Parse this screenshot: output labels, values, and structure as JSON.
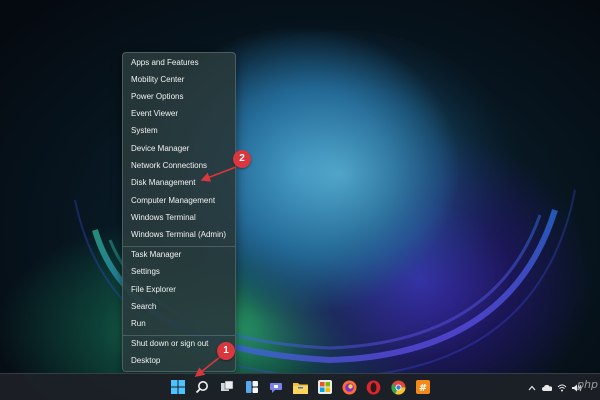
{
  "context_menu": {
    "group1": [
      {
        "label": "Apps and Features"
      },
      {
        "label": "Mobility Center"
      },
      {
        "label": "Power Options"
      },
      {
        "label": "Event Viewer"
      },
      {
        "label": "System"
      },
      {
        "label": "Device Manager"
      },
      {
        "label": "Network Connections"
      },
      {
        "label": "Disk Management"
      },
      {
        "label": "Computer Management"
      },
      {
        "label": "Windows Terminal"
      },
      {
        "label": "Windows Terminal (Admin)"
      }
    ],
    "group2": [
      {
        "label": "Task Manager"
      },
      {
        "label": "Settings"
      },
      {
        "label": "File Explorer"
      },
      {
        "label": "Search"
      },
      {
        "label": "Run"
      }
    ],
    "group3": [
      {
        "label": "Shut down or sign out"
      },
      {
        "label": "Desktop"
      }
    ]
  },
  "annotations": {
    "badge1": "1",
    "badge2": "2",
    "color": "#d9363e"
  },
  "taskbar": {
    "icons": [
      "windows-start-icon",
      "search-icon",
      "task-view-icon",
      "widgets-icon",
      "teams-chat-icon",
      "file-explorer-icon",
      "edge-icon",
      "store-icon",
      "firefox-icon",
      "opera-icon",
      "chrome-icon",
      "slack-icon"
    ]
  },
  "watermark": "php"
}
